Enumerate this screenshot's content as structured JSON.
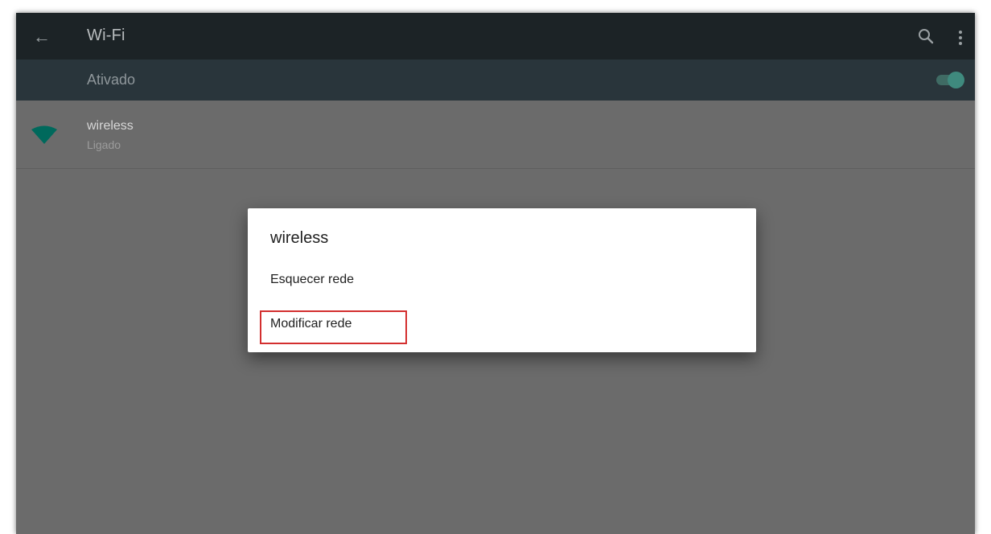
{
  "appbar": {
    "title": "Wi-Fi",
    "back_icon": "arrow-left-icon",
    "search_icon": "search-icon",
    "more_icon": "more-vert-icon"
  },
  "switchbar": {
    "label": "Ativado",
    "toggle_on": true
  },
  "networks": [
    {
      "name": "wireless",
      "status": "Ligado",
      "icon": "wifi-icon"
    }
  ],
  "dialog": {
    "title": "wireless",
    "items": [
      {
        "label": "Esquecer rede"
      },
      {
        "label": "Modificar rede",
        "highlighted": true
      }
    ]
  },
  "colors": {
    "appbar": "#1c2326",
    "switchbar": "#29353b",
    "scrim": "#6b6b6b",
    "accent": "#00695c",
    "highlight": "#d32f2f"
  }
}
